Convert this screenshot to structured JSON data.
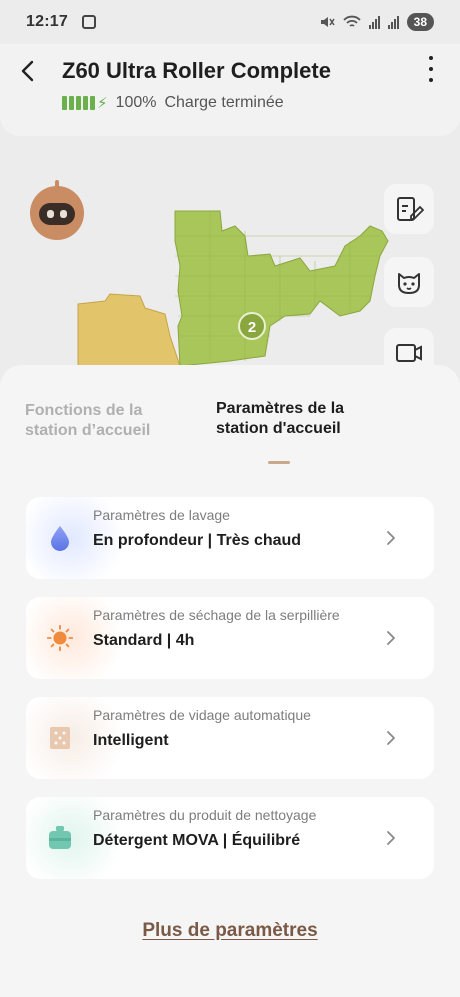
{
  "status_bar": {
    "time": "12:17",
    "battery_level": "38"
  },
  "header": {
    "title": "Z60 Ultra Roller Complete",
    "battery_percent": "100%",
    "charge_status": "Charge terminée"
  },
  "map": {
    "zone_number": "2"
  },
  "tabs": [
    {
      "label": "Fonctions de la station d’accueil",
      "active": false
    },
    {
      "label": "Paramètres de la station d'accueil",
      "active": true
    }
  ],
  "settings": [
    {
      "label": "Paramètres de lavage",
      "value": "En profondeur | Très chaud",
      "icon": "water-drop-icon"
    },
    {
      "label": "Paramètres de séchage de la serpillière",
      "value": "Standard | 4h",
      "icon": "sun-icon"
    },
    {
      "label": "Paramètres de vidage automatique",
      "value": "Intelligent",
      "icon": "dust-bag-icon"
    },
    {
      "label": "Paramètres du produit de nettoyage",
      "value": "Détergent MOVA | Équilibré",
      "icon": "detergent-icon"
    }
  ],
  "more_link": "Plus de paramètres",
  "colors": {
    "accent_link": "#7a5a46",
    "map_green": "#a9c65a",
    "map_yellow": "#e2c56b",
    "battery_green": "#6ab04c"
  }
}
